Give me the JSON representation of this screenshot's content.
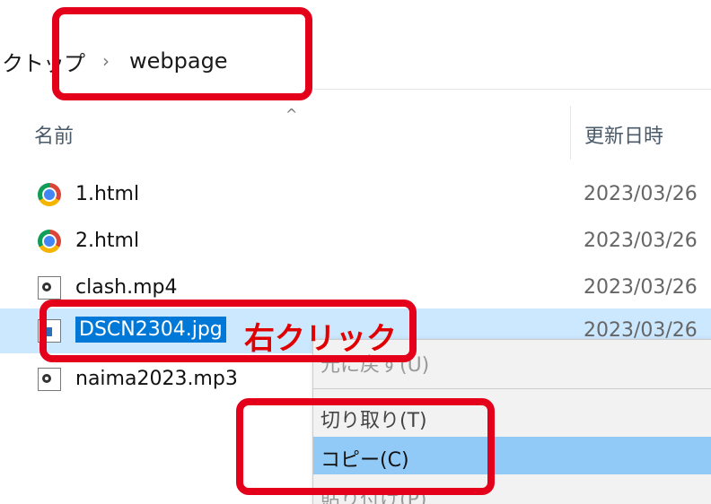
{
  "breadcrumb": {
    "previous": "クトップ",
    "separator": "›",
    "current": "webpage"
  },
  "columns": {
    "name": "名前",
    "sort_indicator": "^",
    "date": "更新日時"
  },
  "files": [
    {
      "name": "1.html",
      "date": "2023/03/26",
      "icon": "chrome-icon"
    },
    {
      "name": "2.html",
      "date": "2023/03/26",
      "icon": "chrome-icon"
    },
    {
      "name": "clash.mp4",
      "date": "2023/03/26",
      "icon": "media-file-icon"
    },
    {
      "name": "DSCN2304.jpg",
      "date": "2023/03/26",
      "icon": "image-file-icon",
      "selected": true
    },
    {
      "name": "naima2023.mp3",
      "date": "",
      "icon": "media-file-icon"
    }
  ],
  "context_menu": {
    "items": [
      {
        "label": "元に戻す(U)",
        "state": "faded"
      },
      {
        "label": "切り取り(T)",
        "state": "normal"
      },
      {
        "label": "コピー(C)",
        "state": "highlighted"
      },
      {
        "label": "貼り付け(P)",
        "state": "faded"
      }
    ]
  },
  "annotation": {
    "label": "右クリック",
    "color": "#e4001b"
  },
  "colors": {
    "selection_row": "#cce8ff",
    "selection_text": "#0078d7",
    "menu_highlight": "#91c9f7"
  }
}
